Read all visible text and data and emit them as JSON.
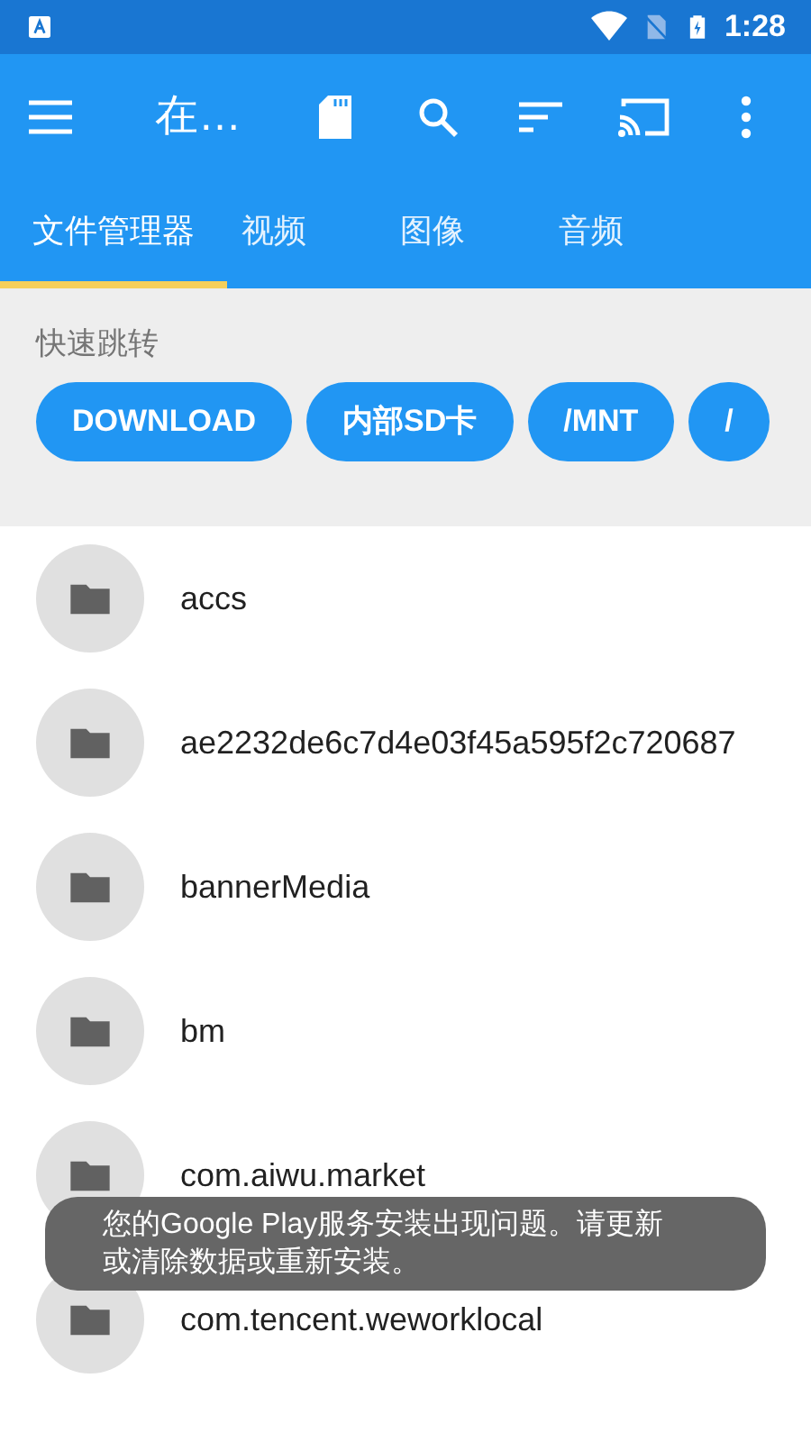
{
  "status_bar": {
    "time": "1:28"
  },
  "toolbar": {
    "title": "在…"
  },
  "tabs": [
    {
      "label": "文件管理器",
      "selected": true
    },
    {
      "label": "视频",
      "selected": false
    },
    {
      "label": "图像",
      "selected": false
    },
    {
      "label": "音频",
      "selected": false
    }
  ],
  "quick_jump": {
    "heading": "快速跳转",
    "chips": [
      "DOWNLOAD",
      "内部SD卡",
      "/MNT",
      "/"
    ]
  },
  "files": [
    {
      "name": "accs"
    },
    {
      "name": "ae2232de6c7d4e03f45a595f2c720687"
    },
    {
      "name": "bannerMedia"
    },
    {
      "name": "bm"
    },
    {
      "name": "com.aiwu.market"
    },
    {
      "name": "com.tencent.weworklocal"
    }
  ],
  "toast": {
    "message": "您的Google Play服务安装出现问题。请更新或清除数据或重新安装。"
  }
}
